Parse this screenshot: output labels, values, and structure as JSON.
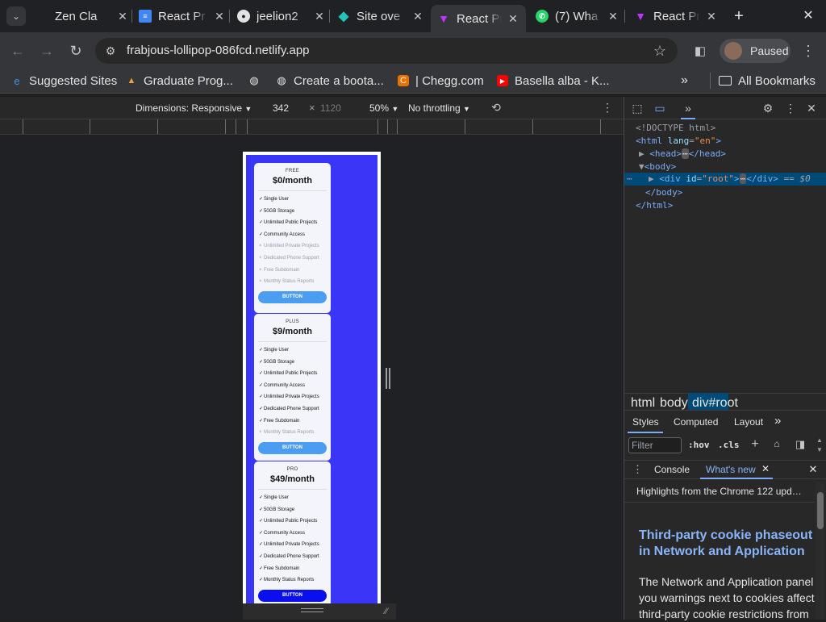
{
  "tabs": [
    {
      "title": "Zen Cla",
      "favicon": "zen-icon"
    },
    {
      "title": "React Pr",
      "favicon": "docs-icon"
    },
    {
      "title": "jeelion2",
      "favicon": "github-icon"
    },
    {
      "title": "Site ove",
      "favicon": "netlify-icon"
    },
    {
      "title": "React Pr",
      "favicon": "vite-icon",
      "active": true
    },
    {
      "title": "(7) Wha",
      "favicon": "whatsapp-icon"
    },
    {
      "title": "React Pr",
      "favicon": "vite-icon"
    }
  ],
  "toolbar": {
    "url": "frabjous-lollipop-086fcd.netlify.app",
    "profile_status": "Paused"
  },
  "bookmarks": [
    {
      "label": "Suggested Sites"
    },
    {
      "label": "Graduate Prog..."
    },
    {
      "label": ""
    },
    {
      "label": "Create a boota..."
    },
    {
      "label": "| Chegg.com"
    },
    {
      "label": "Basella alba - K..."
    }
  ],
  "bookmarks_all": "All Bookmarks",
  "device_toolbar": {
    "dimensions": "Dimensions: Responsive",
    "width": "342",
    "times": "×",
    "height": "1120",
    "zoom": "50%",
    "throttling": "No throttling"
  },
  "pricing": [
    {
      "tier": "FREE",
      "price": "$0/month",
      "features": [
        {
          "text": "Single User",
          "enabled": true
        },
        {
          "text": "50GB Storage",
          "enabled": true
        },
        {
          "text": "Unlimited Public Projects",
          "enabled": true
        },
        {
          "text": "Community Access",
          "enabled": true
        },
        {
          "text": "Unlimited Private Projects",
          "enabled": false
        },
        {
          "text": "Dedicated Phone Support",
          "enabled": false
        },
        {
          "text": "Free Subdomain",
          "enabled": false
        },
        {
          "text": "Monthly Status Reports",
          "enabled": false
        }
      ],
      "button": "BUTTON"
    },
    {
      "tier": "PLUS",
      "price": "$9/month",
      "features": [
        {
          "text": "Single User",
          "enabled": true
        },
        {
          "text": "50GB Storage",
          "enabled": true
        },
        {
          "text": "Unlimited Public Projects",
          "enabled": true
        },
        {
          "text": "Community Access",
          "enabled": true
        },
        {
          "text": "Unlimited Private Projects",
          "enabled": true
        },
        {
          "text": "Dedicated Phone Support",
          "enabled": true
        },
        {
          "text": "Free Subdomain",
          "enabled": true
        },
        {
          "text": "Monthly Status Reports",
          "enabled": false
        }
      ],
      "button": "BUTTON"
    },
    {
      "tier": "PRO",
      "price": "$49/month",
      "features": [
        {
          "text": "Single User",
          "enabled": true
        },
        {
          "text": "50GB Storage",
          "enabled": true
        },
        {
          "text": "Unlimited Public Projects",
          "enabled": true
        },
        {
          "text": "Community Access",
          "enabled": true
        },
        {
          "text": "Unlimited Private Projects",
          "enabled": true
        },
        {
          "text": "Dedicated Phone Support",
          "enabled": true
        },
        {
          "text": "Free Subdomain",
          "enabled": true
        },
        {
          "text": "Monthly Status Reports",
          "enabled": true
        }
      ],
      "button": "BUTTON"
    }
  ],
  "marks": {
    "check": "✓",
    "cross": "×"
  },
  "devtools": {
    "dom": {
      "doctype": "<!DOCTYPE html>",
      "html_open_tag": "<html",
      "html_attr": "lang",
      "html_attr_val": "\"en\"",
      "head": "<head>",
      "head_close": "</head>",
      "body_open": "<body>",
      "div_open": "<div",
      "div_attr": "id",
      "div_attr_val": "\"root\"",
      "div_close": "</div>",
      "eq": "== $0",
      "body_close": "</body>",
      "html_close": "</html>",
      "ellipsis": "⋯"
    },
    "breadcrumbs": [
      "html",
      "body",
      "div#root"
    ],
    "style_tabs": [
      "Styles",
      "Computed",
      "Layout"
    ],
    "filter_placeholder": "Filter",
    "hov": ":hov",
    "cls": ".cls",
    "drawer_tabs": [
      "Console",
      "What's new"
    ],
    "highlights": "Highlights from the Chrome 122 upd…",
    "whats_new_title": "Third-party cookie phaseout in Network and Application",
    "whats_new_body": [
      "The Network and Application panel",
      "you warnings next to cookies affect",
      "third-party cookie restrictions from"
    ]
  },
  "colors": {
    "accent": "#7cacf8",
    "page_bg": "#3a36f8",
    "card_button": "#4a9df0",
    "pro_button": "#0a0ff0"
  }
}
